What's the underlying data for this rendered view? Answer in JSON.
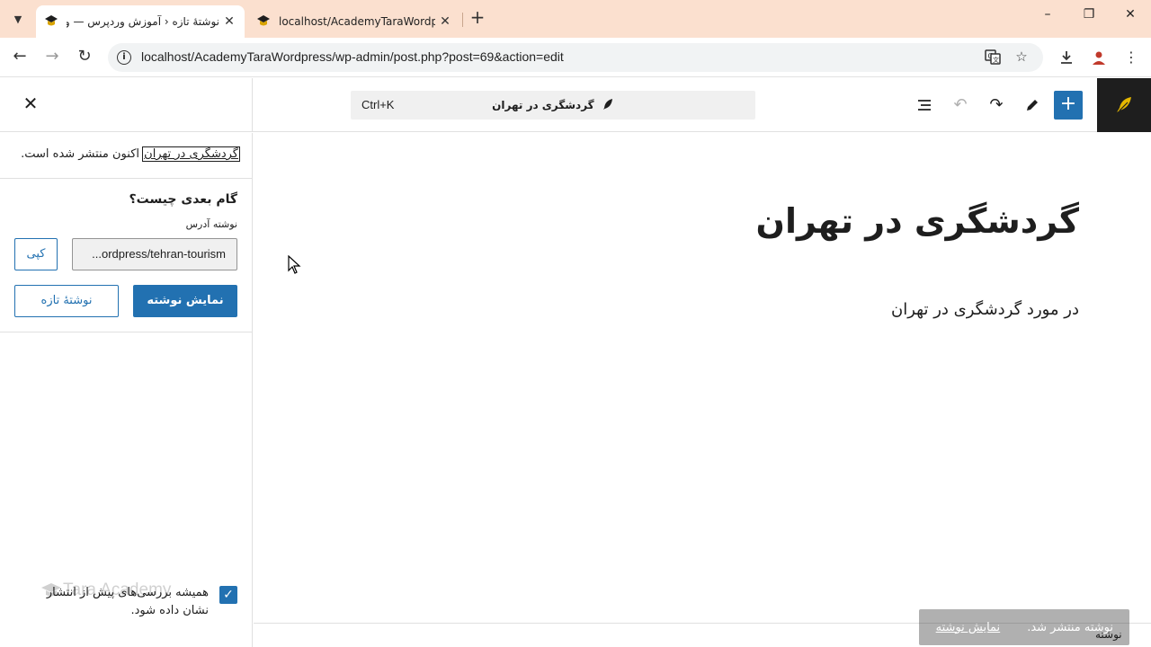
{
  "browser": {
    "tabs": [
      {
        "title": "نوشتهٔ تازه ‹ آموزش وردپرس — ور",
        "active": true
      },
      {
        "title": "localhost/AcademyTaraWordpre",
        "active": false
      }
    ],
    "url": "localhost/AcademyTaraWordpress/wp-admin/post.php?post=69&action=edit",
    "window_controls": {
      "minimize": "–",
      "restore": "❐",
      "close": "✕"
    }
  },
  "editor": {
    "command_shortcut": "Ctrl+K",
    "document_title": "گردشگری در تهران",
    "toolbar_icons": [
      "add-block-icon",
      "pen-icon",
      "redo-icon",
      "undo-icon",
      "list-view-icon"
    ]
  },
  "publish_panel": {
    "post_link": "گردشگری در تهران",
    "published_suffix": " اکنون منتشر شده است.",
    "next_title": "گام بعدی چیست؟",
    "address_label": "نوشته آدرس",
    "url_value": "...ordpress/tehran-tourism",
    "copy_label": "کپی",
    "view_post_label": "نمایش نوشته",
    "new_post_label": "نوشتهٔ تازه",
    "checkbox_label": "همیشه بررسی‌های پیش از انتشار نشان داده شود.",
    "checkbox_checked": true
  },
  "watermark": "Tara Academy",
  "content": {
    "title": "گردشگری در تهران",
    "paragraph": "در مورد گردشگری در تهران"
  },
  "footer": {
    "breadcrumb": "نوشته"
  },
  "snackbar": {
    "message": "نوشته منتشر شد.",
    "link": "نمایش نوشته"
  },
  "colors": {
    "accent": "#2271b1",
    "tabbar": "#fbe0cf",
    "dark": "#1e1e1e"
  }
}
